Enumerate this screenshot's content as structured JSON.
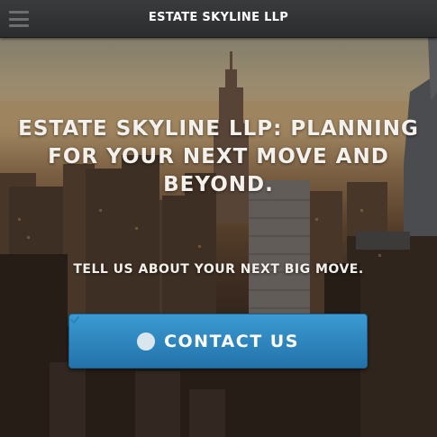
{
  "header": {
    "brand": "ESTATE SKYLINE LLP",
    "menu_icon": "hamburger-menu-icon"
  },
  "hero": {
    "headline": "ESTATE SKYLINE LLP: PLANNING FOR YOUR NEXT MOVE AND BEYOND.",
    "subline": "TELL US ABOUT YOUR NEXT BIG MOVE.",
    "background_image": "city-skyline-photo"
  },
  "cta": {
    "label": "CONTACT US",
    "icon": "check-circle-icon",
    "color": "#2a85c0"
  }
}
